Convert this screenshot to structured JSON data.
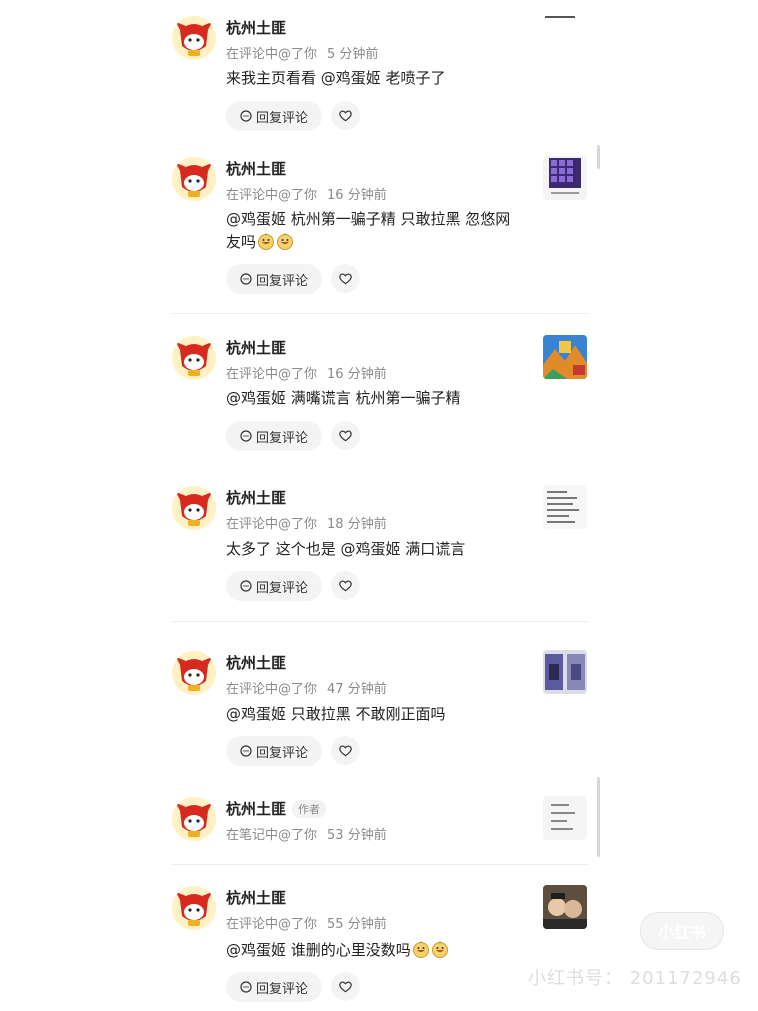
{
  "comments": [
    {
      "user": "杭州土匪",
      "meta": "在评论中@了你",
      "time": "5 分钟前",
      "text": "来我主页看看 @鸡蛋姬 老喷子了",
      "reply_label": "回复评论"
    },
    {
      "user": "杭州土匪",
      "meta": "在评论中@了你",
      "time": "16 分钟前",
      "text": "@鸡蛋姬 杭州第一骗子精 只敢拉黑 忽悠网",
      "text2": "友吗",
      "reply_label": "回复评论"
    },
    {
      "user": "杭州土匪",
      "meta": "在评论中@了你",
      "time": "16 分钟前",
      "text": "@鸡蛋姬 满嘴谎言 杭州第一骗子精",
      "reply_label": "回复评论"
    },
    {
      "user": "杭州土匪",
      "meta": "在评论中@了你",
      "time": "18 分钟前",
      "text": "太多了 这个也是 @鸡蛋姬 满口谎言",
      "reply_label": "回复评论"
    },
    {
      "user": "杭州土匪",
      "meta": "在评论中@了你",
      "time": "47 分钟前",
      "text": "@鸡蛋姬  只敢拉黑 不敢刚正面吗",
      "reply_label": "回复评论"
    },
    {
      "user": "杭州土匪",
      "tag": "作者",
      "meta": "在笔记中@了你",
      "time": "53 分钟前"
    },
    {
      "user": "杭州土匪",
      "meta": "在评论中@了你",
      "time": "55 分钟前",
      "text": "@鸡蛋姬 谁删的心里没数吗",
      "reply_label": "回复评论"
    }
  ],
  "watermark": {
    "logo": "小红书",
    "id": "小红书号： 201172946"
  },
  "colors": {
    "accent": "#e1261c",
    "muted": "#8a8a8a",
    "button_bg": "#f4f4f4"
  }
}
